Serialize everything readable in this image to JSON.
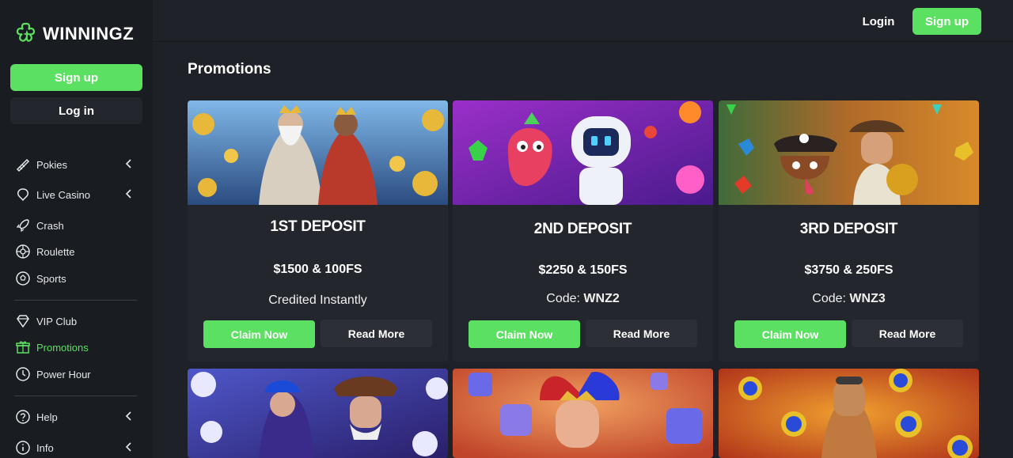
{
  "brand": {
    "name": "WINNINGZ",
    "accent": "#5ce062"
  },
  "sidebar": {
    "signup_label": "Sign up",
    "login_label": "Log in",
    "items": [
      {
        "label": "Pokies",
        "icon": "pokies-icon",
        "chevron": true
      },
      {
        "label": "Live Casino",
        "icon": "live-casino-icon",
        "chevron": true
      },
      {
        "label": "Crash",
        "icon": "rocket-icon",
        "chevron": false
      },
      {
        "label": "Roulette",
        "icon": "roulette-icon",
        "chevron": false
      },
      {
        "label": "Sports",
        "icon": "ball-icon",
        "chevron": false
      },
      {
        "label": "VIP Club",
        "icon": "diamond-icon",
        "chevron": false
      },
      {
        "label": "Promotions",
        "icon": "gift-icon",
        "chevron": false,
        "active": true
      },
      {
        "label": "Power Hour",
        "icon": "clock-icon",
        "chevron": false
      },
      {
        "label": "Help",
        "icon": "help-icon",
        "chevron": true
      },
      {
        "label": "Info",
        "icon": "info-icon",
        "chevron": true
      }
    ]
  },
  "topbar": {
    "login_label": "Login",
    "signup_label": "Sign up"
  },
  "main": {
    "title": "Promotions",
    "cards": [
      {
        "title": "1ST DEPOSIT",
        "amount": "$1500 & 100FS",
        "sub_prefix": "Credited Instantly",
        "sub_code": "",
        "claim_label": "Claim Now",
        "read_label": "Read More"
      },
      {
        "title": "2ND DEPOSIT",
        "amount": "$2250 & 150FS",
        "sub_prefix": "Code: ",
        "sub_code": "WNZ2",
        "claim_label": "Claim Now",
        "read_label": "Read More"
      },
      {
        "title": "3RD DEPOSIT",
        "amount": "$3750 & 250FS",
        "sub_prefix": "Code: ",
        "sub_code": "WNZ3",
        "claim_label": "Claim Now",
        "read_label": "Read More"
      }
    ]
  }
}
